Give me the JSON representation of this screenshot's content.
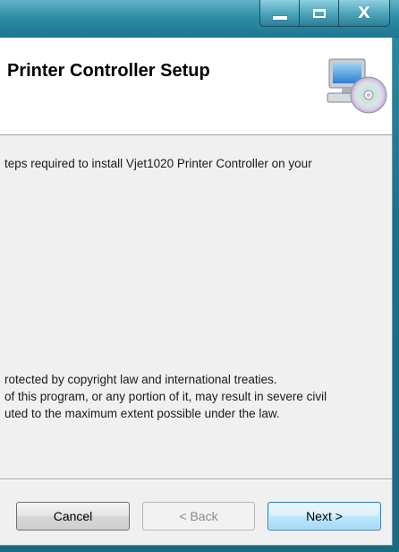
{
  "window": {
    "caption_buttons": {
      "minimize_icon": "minimize-icon",
      "maximize_icon": "maximize-icon",
      "close_symbol": "X"
    }
  },
  "header": {
    "title": "Printer Controller Setup",
    "icon": "computer-disc-icon"
  },
  "content": {
    "intro": "teps required to install Vjet1020 Printer Controller on your",
    "copyright_lines": [
      "rotected by copyright law and international treaties.",
      "of this program, or any portion of it, may result in severe civil",
      "uted to the maximum extent possible under the law."
    ]
  },
  "buttons": {
    "cancel": "Cancel",
    "back": "< Back",
    "next": "Next >"
  },
  "colors": {
    "titlebar": "#2f8da5",
    "client_background": "#f0f0f0",
    "header_background": "#ffffff",
    "next_button": "#bee6fd"
  }
}
